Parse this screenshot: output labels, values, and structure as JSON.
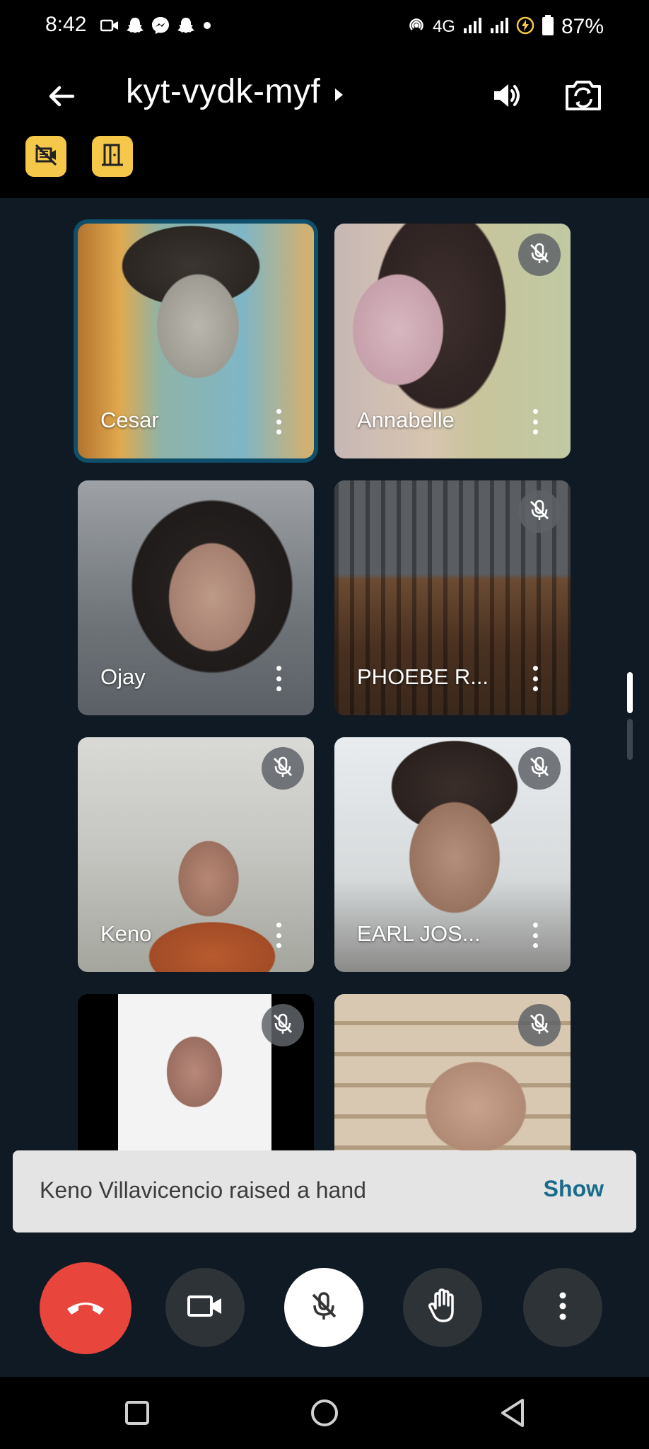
{
  "status_bar": {
    "time": "8:42",
    "network": "4G",
    "battery": "87%",
    "left_icons": [
      "video-camera-icon",
      "snapchat-icon",
      "messenger-icon",
      "snapchat-icon",
      "dot-icon"
    ],
    "right_icons": [
      "hotspot-icon",
      "signal-icon",
      "signal-icon",
      "charging-icon",
      "battery-icon"
    ]
  },
  "header": {
    "meeting_code": "kyt-vydk-myf",
    "back_icon": "arrow-back-icon",
    "expand_icon": "caret-right-icon",
    "speaker_icon": "speaker-icon",
    "switch_camera_icon": "switch-camera-icon",
    "badges": [
      "no-recording-icon",
      "door-icon"
    ],
    "badge_color": "#f6c84a"
  },
  "participants": [
    {
      "name": "Cesar",
      "muted": false,
      "active_speaker": true
    },
    {
      "name": "Annabelle",
      "muted": true,
      "active_speaker": false
    },
    {
      "name": "Ojay",
      "muted": false,
      "active_speaker": false
    },
    {
      "name": "PHOEBE R...",
      "muted": true,
      "active_speaker": false
    },
    {
      "name": "Keno",
      "muted": true,
      "active_speaker": false
    },
    {
      "name": "EARL JOS...",
      "muted": true,
      "active_speaker": false
    },
    {
      "name": "",
      "muted": true,
      "active_speaker": false
    },
    {
      "name": "",
      "muted": true,
      "active_speaker": false
    }
  ],
  "toast": {
    "message": "Keno Villavicencio raised a hand",
    "action": "Show"
  },
  "controls": {
    "end_call_icon": "end-call-icon",
    "camera_icon": "video-camera-icon",
    "mic_icon": "mic-off-icon",
    "hand_icon": "raise-hand-icon",
    "more_icon": "more-vertical-icon"
  },
  "colors": {
    "background": "#0f1a25",
    "end_call": "#e8453c",
    "control_button": "#2e3338",
    "active_border": "#0f4f6c",
    "toast_bg": "#e4e4e4",
    "toast_action": "#1a6b8a"
  },
  "nav_bar": {
    "icons": [
      "recent-apps-icon",
      "home-icon",
      "back-icon"
    ]
  }
}
